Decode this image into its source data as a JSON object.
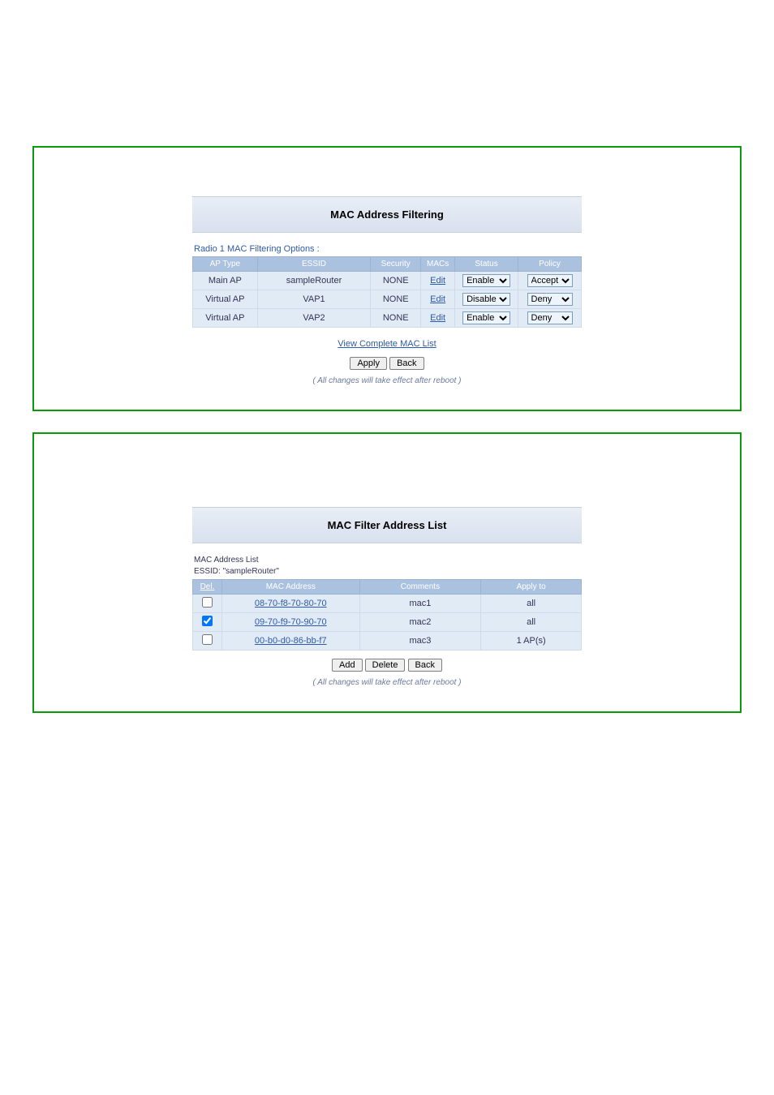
{
  "panel1": {
    "title": "MAC Address Filtering",
    "options_caption": "Radio 1 MAC Filtering Options :",
    "headers": {
      "ap_type": "AP Type",
      "essid": "ESSID",
      "security": "Security",
      "macs": "MACs",
      "status": "Status",
      "policy": "Policy"
    },
    "rows": [
      {
        "ap_type": "Main AP",
        "essid": "sampleRouter",
        "security": "NONE",
        "macs": "Edit",
        "status": "Enable",
        "policy": "Accept"
      },
      {
        "ap_type": "Virtual AP",
        "essid": "VAP1",
        "security": "NONE",
        "macs": "Edit",
        "status": "Disable",
        "policy": "Deny"
      },
      {
        "ap_type": "Virtual AP",
        "essid": "VAP2",
        "security": "NONE",
        "macs": "Edit",
        "status": "Enable",
        "policy": "Deny"
      }
    ],
    "status_options": [
      "Enable",
      "Disable"
    ],
    "policy_options": [
      "Accept",
      "Deny"
    ],
    "view_link": "View Complete MAC List",
    "btn_apply": "Apply",
    "btn_back": "Back",
    "note": "( All changes will take effect after reboot )"
  },
  "panel2": {
    "title": "MAC Filter Address List",
    "list_line1": "MAC Address List",
    "list_line2": "ESSID: \"sampleRouter\"",
    "headers": {
      "del": "Del.",
      "mac": "MAC Address",
      "comments": "Comments",
      "apply_to": "Apply to"
    },
    "rows": [
      {
        "checked": false,
        "mac": "08-70-f8-70-80-70",
        "comments": "mac1",
        "apply_to": "all"
      },
      {
        "checked": true,
        "mac": "09-70-f9-70-90-70",
        "comments": "mac2",
        "apply_to": "all"
      },
      {
        "checked": false,
        "mac": "00-b0-d0-86-bb-f7",
        "comments": "mac3",
        "apply_to": "1 AP(s)"
      }
    ],
    "btn_add": "Add",
    "btn_delete": "Delete",
    "btn_back": "Back",
    "note": "( All changes will take effect after reboot )"
  }
}
